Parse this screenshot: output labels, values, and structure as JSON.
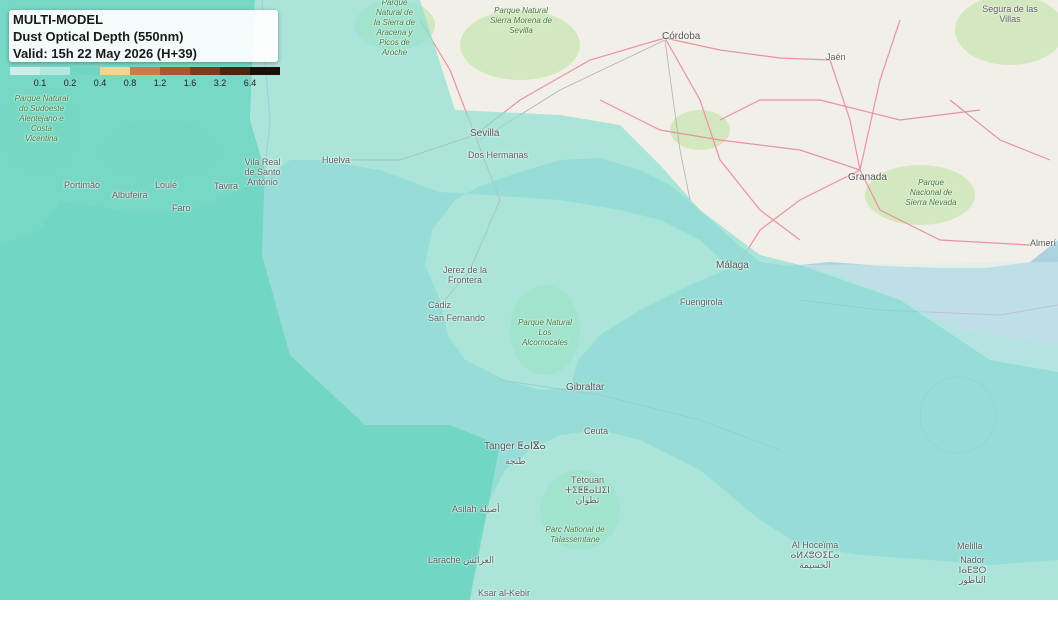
{
  "legend": {
    "line1": "MULTI-MODEL",
    "line2": "Dust Optical Depth (550nm)",
    "line3": "Valid: 15h 22 May 2026 (H+39)"
  },
  "colorbar": {
    "colors": [
      "#cfeee9",
      "#b3e8e0",
      "#6ed6c2",
      "#f0d78c",
      "#c97e45",
      "#a55a2a",
      "#7a3d1a",
      "#4a2511",
      "#1c0f08"
    ],
    "ticks": [
      "0.1",
      "0.2",
      "0.4",
      "0.8",
      "1.2",
      "1.6",
      "3.2",
      "6.4"
    ]
  },
  "map_labels": {
    "sevilla": "Sevilla",
    "dos_hermanas": "Dos Hermanas",
    "cordoba": "Córdoba",
    "jaen": "Jaén",
    "granada": "Granada",
    "malaga": "Málaga",
    "fuengirola": "Fuengirola",
    "almeria": "Almerí",
    "huelva": "Huelva",
    "jerez": "Jerez de la Frontera",
    "cadiz": "Cádiz",
    "san_fernando": "San Fernando",
    "gibraltar": "Gibraltar",
    "ceuta": "Ceuta",
    "tanger": "Tanger ⵟⴰⵏⴵⴰ",
    "tanger_ar": "طنجة",
    "tetouan": "Tétouan ⵜⵉⵟⵟⴰⵡⵉⵏ تطوان",
    "alhoceima": "Al Hoceïma ⴰⵍⵃⵓⵙⵉⵎⴰ الحسيمة",
    "asilah": "Asilah أصيلة",
    "larache": "Larache العرائش",
    "ksar": "Ksar al-Kebir",
    "nador": "Nador ⵏⴰⴹⵓⵔ الناظور",
    "melilla": "Melilla",
    "faro": "Faro",
    "loule": "Loulé",
    "albufeira": "Albufeira",
    "portimao": "Portimão",
    "tavira": "Tavira",
    "vila_real": "Vila Real de Santo António",
    "segura": "Segura de las Villas",
    "park_sierra_morena": "Parque Natural Sierra Morena de Sevilla",
    "park_aracena": "Parque Natural de la Sierra de Aracena y Picos de Aroche",
    "park_sierra_nevada": "Parque Nacional de Sierra Nevada",
    "park_alcornocales": "Parque Natural Los Alcornocales",
    "park_sudoeste": "Parque Natural do Sudoeste Alentejano e Costa Vicentina",
    "park_talassemtane": "Parc National de Talassemtane"
  }
}
